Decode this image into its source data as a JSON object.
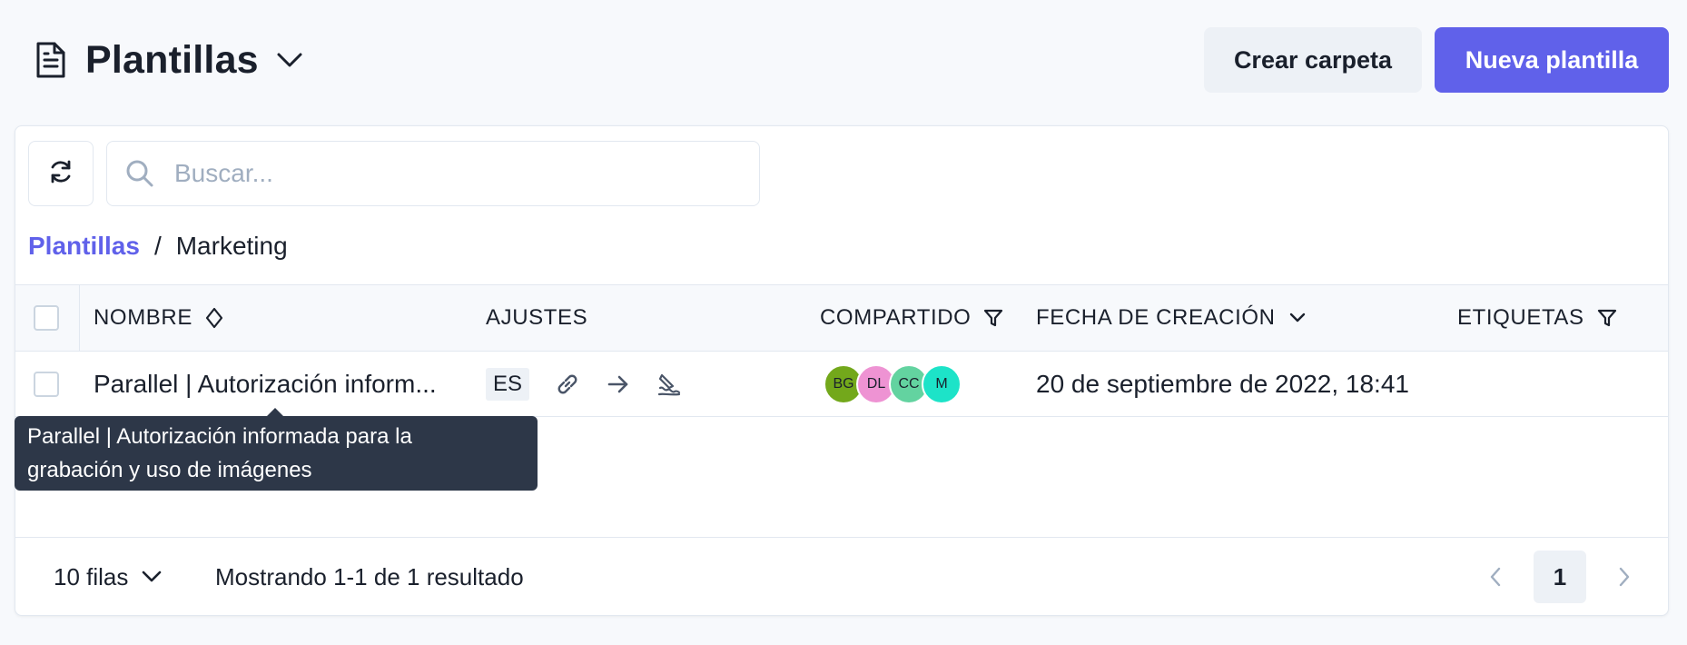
{
  "header": {
    "title": "Plantillas",
    "create_folder_label": "Crear carpeta",
    "new_template_label": "Nueva plantilla"
  },
  "search": {
    "placeholder": "Buscar...",
    "value": ""
  },
  "breadcrumb": {
    "root": "Plantillas",
    "separator": "/",
    "current": "Marketing"
  },
  "table": {
    "columns": {
      "name": "NOMBRE",
      "settings": "AJUSTES",
      "shared": "COMPARTIDO",
      "created": "FECHA DE CREACIÓN",
      "tags": "ETIQUETAS"
    },
    "rows": [
      {
        "name": "Parallel | Autorización inform...",
        "language": "ES",
        "shared_with": [
          {
            "initials": "BG",
            "color": "#73a81b"
          },
          {
            "initials": "DL",
            "color": "#ee93d3"
          },
          {
            "initials": "CC",
            "color": "#63d3a0"
          },
          {
            "initials": "M",
            "color": "#1de3c8"
          }
        ],
        "created": "20 de septiembre de 2022, 18:41",
        "tags": ""
      }
    ]
  },
  "tooltip": {
    "line1": "Parallel | Autorización informada para la",
    "line2": "grabación y uso de imágenes"
  },
  "footer": {
    "rows_per_page": "10 filas",
    "results_text": "Mostrando 1-1 de 1 resultado",
    "current_page": "1"
  },
  "colors": {
    "accent": "#6061ea",
    "tooltip_bg": "#2d3748"
  }
}
